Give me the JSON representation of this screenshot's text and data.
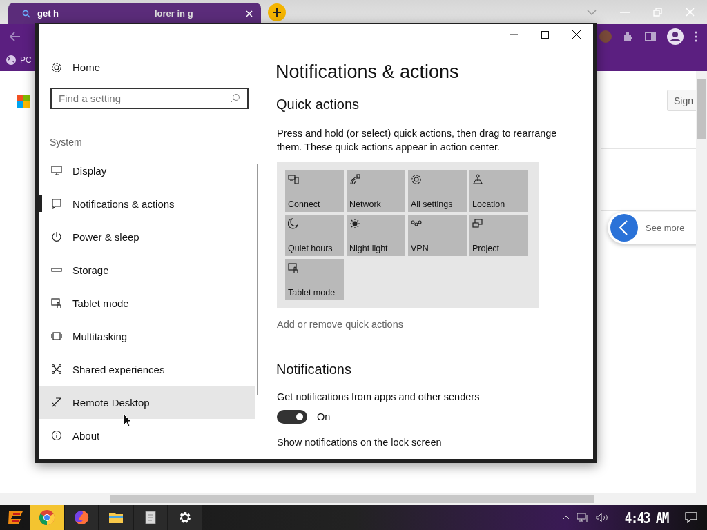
{
  "browser": {
    "tab": {
      "title_start": "get h",
      "title_end": "lorer in g",
      "selected": true
    },
    "bookmark": "PC",
    "page": {
      "sign_in": "Sign",
      "see_more": "See more"
    }
  },
  "settings": {
    "sidebar": {
      "home": "Home",
      "search": {
        "placeholder": "Find a setting"
      },
      "section": "System",
      "items": [
        {
          "label": "Display",
          "selected": false,
          "hovered": false
        },
        {
          "label": "Notifications & actions",
          "selected": true,
          "hovered": false
        },
        {
          "label": "Power & sleep",
          "selected": false,
          "hovered": false
        },
        {
          "label": "Storage",
          "selected": false,
          "hovered": false
        },
        {
          "label": "Tablet mode",
          "selected": false,
          "hovered": false
        },
        {
          "label": "Multitasking",
          "selected": false,
          "hovered": false
        },
        {
          "label": "Shared experiences",
          "selected": false,
          "hovered": false
        },
        {
          "label": "Remote Desktop",
          "selected": false,
          "hovered": true
        },
        {
          "label": "About",
          "selected": false,
          "hovered": false
        }
      ]
    },
    "content": {
      "title": "Notifications & actions",
      "quick_actions": {
        "heading": "Quick actions",
        "description": "Press and hold (or select) quick actions, then drag to rearrange them. These quick actions appear in action center.",
        "tiles": [
          {
            "label": "Connect"
          },
          {
            "label": "Network"
          },
          {
            "label": "All settings"
          },
          {
            "label": "Location"
          },
          {
            "label": "Quiet hours"
          },
          {
            "label": "Night light"
          },
          {
            "label": "VPN"
          },
          {
            "label": "Project"
          },
          {
            "label": "Tablet mode"
          }
        ],
        "link": "Add or remove quick actions"
      },
      "notifications": {
        "heading": "Notifications",
        "settings": [
          {
            "label": "Get notifications from apps and other senders",
            "on": true,
            "state_text": "On"
          }
        ],
        "next_label": "Show notifications on the lock screen"
      }
    }
  },
  "taskbar": {
    "apps": [
      {
        "kind": "chrome",
        "selected": true
      },
      {
        "kind": "firefox",
        "selected": false
      },
      {
        "kind": "folder",
        "selected": false
      },
      {
        "kind": "document",
        "selected": false
      },
      {
        "kind": "settings",
        "selected": false
      }
    ],
    "clock": "4:43 AM"
  }
}
